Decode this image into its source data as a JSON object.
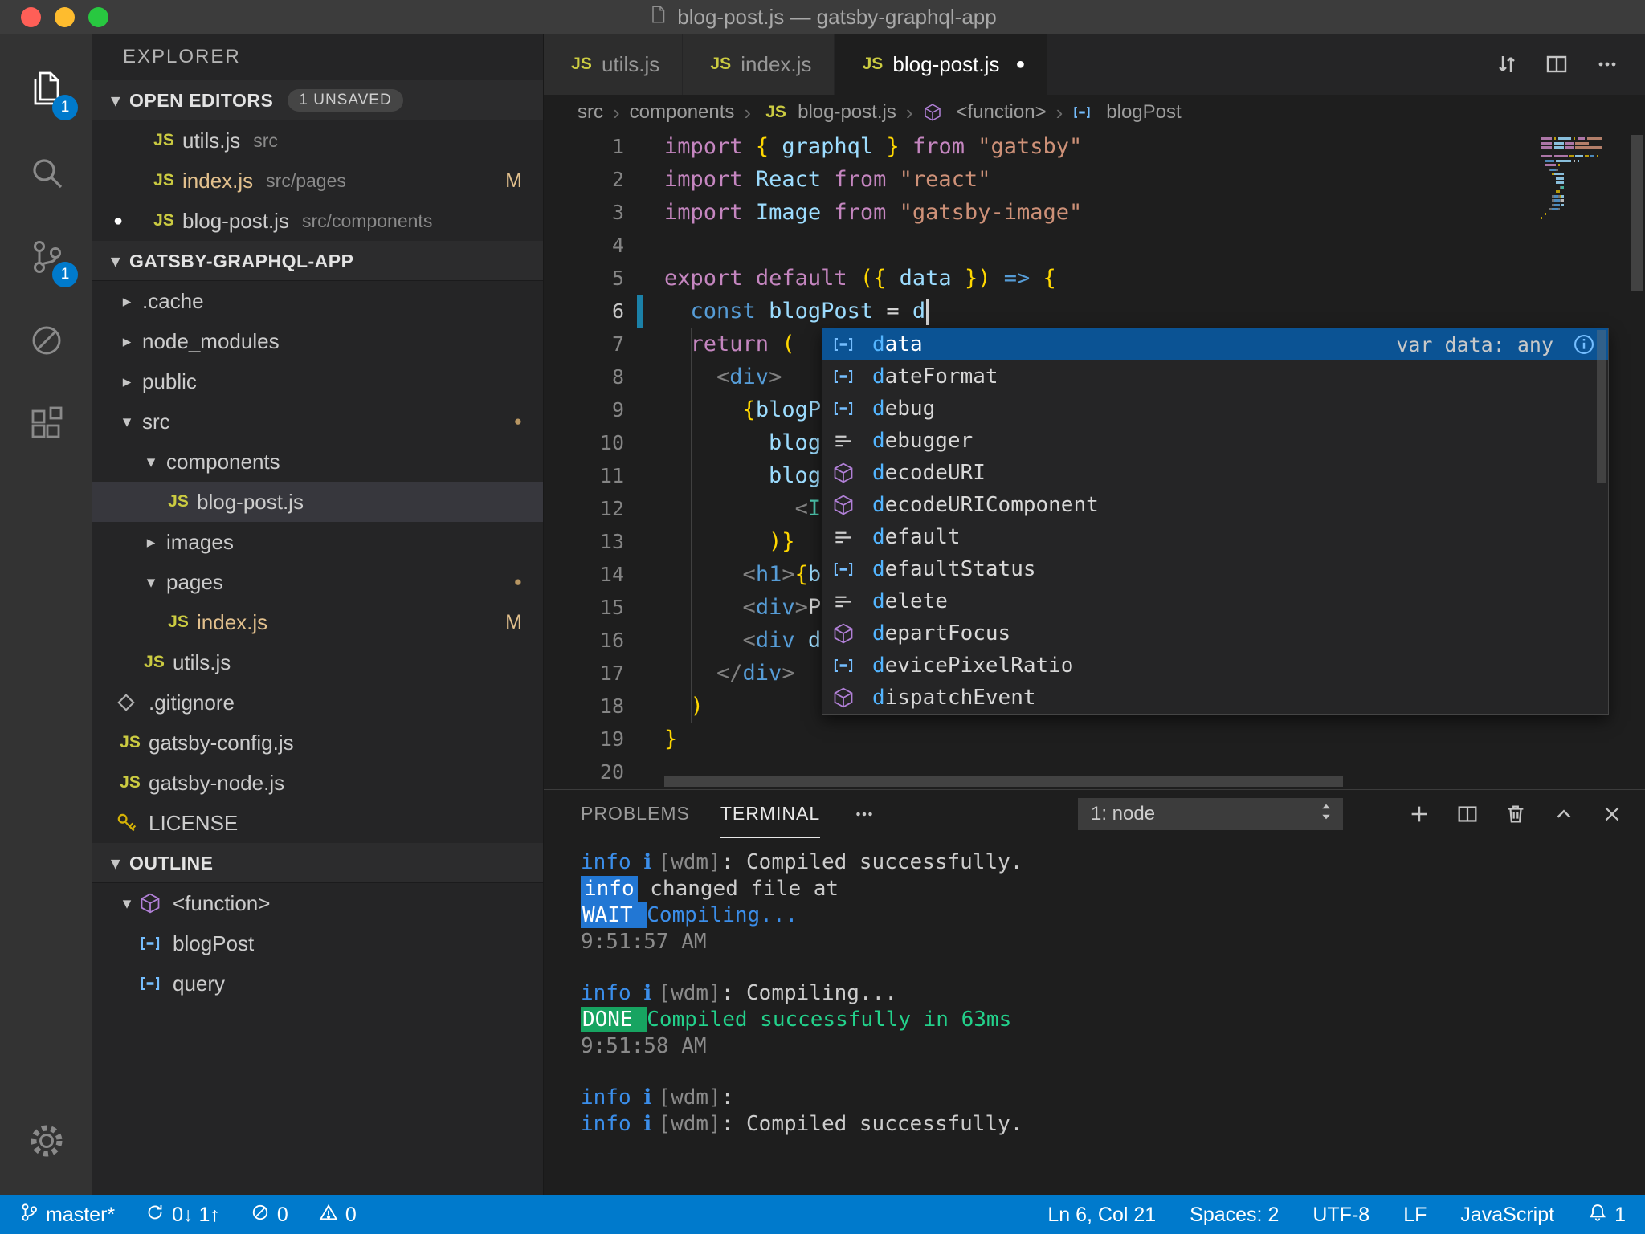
{
  "window": {
    "title": "blog-post.js — gatsby-graphql-app"
  },
  "colors": {
    "accent": "#007acc",
    "status_bar": "#007acc",
    "badge": "#007acc",
    "selection": "#0b5394"
  },
  "activity_bar": {
    "items": [
      {
        "name": "explorer",
        "active": true,
        "badge": "1"
      },
      {
        "name": "search"
      },
      {
        "name": "source-control",
        "badge": "1"
      },
      {
        "name": "debug"
      },
      {
        "name": "extensions"
      }
    ],
    "bottom": [
      {
        "name": "settings"
      }
    ]
  },
  "sidebar": {
    "title": "EXPLORER",
    "sections": [
      {
        "name": "open-editors",
        "label": "OPEN EDITORS",
        "badge": "1 UNSAVED",
        "rows": [
          {
            "label": "utils.js",
            "icon": "js",
            "path": "src"
          },
          {
            "label": "index.js",
            "icon": "js",
            "path": "src/pages",
            "git": "M",
            "modified": true
          },
          {
            "label": "blog-post.js",
            "icon": "js",
            "path": "src/components",
            "dirty": true
          }
        ]
      },
      {
        "name": "workspace",
        "label": "GATSBY-GRAPHQL-APP",
        "rows": [
          {
            "label": ".cache",
            "twisty": "closed",
            "indent": 0
          },
          {
            "label": "node_modules",
            "twisty": "closed",
            "indent": 0
          },
          {
            "label": "public",
            "twisty": "closed",
            "indent": 0
          },
          {
            "label": "src",
            "twisty": "open",
            "indent": 0,
            "dot": true
          },
          {
            "label": "components",
            "twisty": "open",
            "indent": 1
          },
          {
            "label": "blog-post.js",
            "icon": "js",
            "indent": 2,
            "selected": true
          },
          {
            "label": "images",
            "twisty": "closed",
            "indent": 1
          },
          {
            "label": "pages",
            "twisty": "open",
            "indent": 1,
            "dot": true
          },
          {
            "label": "index.js",
            "icon": "js",
            "indent": 2,
            "git": "M",
            "modified": true
          },
          {
            "label": "utils.js",
            "icon": "js",
            "indent": 1
          },
          {
            "label": ".gitignore",
            "icon": "git",
            "indent": 0
          },
          {
            "label": "gatsby-config.js",
            "icon": "js",
            "indent": 0
          },
          {
            "label": "gatsby-node.js",
            "icon": "js",
            "indent": 0
          },
          {
            "label": "LICENSE",
            "icon": "license",
            "indent": 0
          }
        ]
      },
      {
        "name": "outline",
        "label": "OUTLINE",
        "rows": [
          {
            "label": "<function>",
            "twisty": "open",
            "icon": "function",
            "indent": 0
          },
          {
            "label": "blogPost",
            "icon": "variable",
            "indent": 1
          },
          {
            "label": "query",
            "icon": "variable",
            "indent": 1
          }
        ]
      }
    ]
  },
  "editor": {
    "tabs": [
      {
        "label": "utils.js",
        "icon": "js"
      },
      {
        "label": "index.js",
        "icon": "js"
      },
      {
        "label": "blog-post.js",
        "icon": "js",
        "active": true,
        "dirty": true
      }
    ],
    "actions": [
      "swap-editors",
      "split-editor",
      "more-editor-actions"
    ],
    "breadcrumb": [
      {
        "label": "src"
      },
      {
        "label": "components"
      },
      {
        "label": "blog-post.js",
        "icon": "js"
      },
      {
        "label": "<function>",
        "icon": "function"
      },
      {
        "label": "blogPost",
        "icon": "variable"
      }
    ],
    "code": {
      "lines": [
        {
          "n": 1,
          "t": [
            [
              "kw",
              "import"
            ],
            [
              "fg",
              " "
            ],
            [
              "br",
              "{"
            ],
            [
              "fg",
              " "
            ],
            [
              "id",
              "graphql"
            ],
            [
              "fg",
              " "
            ],
            [
              "br",
              "}"
            ],
            [
              "fg",
              " "
            ],
            [
              "kw",
              "from"
            ],
            [
              "fg",
              " "
            ],
            [
              "str",
              "\"gatsby\""
            ]
          ]
        },
        {
          "n": 2,
          "t": [
            [
              "kw",
              "import"
            ],
            [
              "fg",
              " "
            ],
            [
              "id",
              "React"
            ],
            [
              "fg",
              " "
            ],
            [
              "kw",
              "from"
            ],
            [
              "fg",
              " "
            ],
            [
              "str",
              "\"react\""
            ]
          ]
        },
        {
          "n": 3,
          "t": [
            [
              "kw",
              "import"
            ],
            [
              "fg",
              " "
            ],
            [
              "id",
              "Image"
            ],
            [
              "fg",
              " "
            ],
            [
              "kw",
              "from"
            ],
            [
              "fg",
              " "
            ],
            [
              "str",
              "\"gatsby-image\""
            ]
          ]
        },
        {
          "n": 4,
          "t": []
        },
        {
          "n": 5,
          "t": [
            [
              "kw",
              "export"
            ],
            [
              "fg",
              " "
            ],
            [
              "kw",
              "default"
            ],
            [
              "fg",
              " "
            ],
            [
              "br",
              "({"
            ],
            [
              "fg",
              " "
            ],
            [
              "id",
              "data"
            ],
            [
              "fg",
              " "
            ],
            [
              "br",
              "})"
            ],
            [
              "fg",
              " "
            ],
            [
              "op",
              "=>"
            ],
            [
              "fg",
              " "
            ],
            [
              "br",
              "{"
            ]
          ]
        },
        {
          "n": 6,
          "git": true,
          "cursor": true,
          "t": [
            [
              "fg",
              "  "
            ],
            [
              "st",
              "const"
            ],
            [
              "fg",
              " "
            ],
            [
              "id",
              "blogPost"
            ],
            [
              "fg",
              " "
            ],
            [
              "eq",
              "="
            ],
            [
              "fg",
              " "
            ],
            [
              "id",
              "d"
            ]
          ]
        },
        {
          "n": 7,
          "guide": true,
          "t": [
            [
              "fg",
              "  "
            ],
            [
              "kw",
              "return"
            ],
            [
              "fg",
              " "
            ],
            [
              "br",
              "("
            ]
          ]
        },
        {
          "n": 8,
          "guide": true,
          "t": [
            [
              "fg",
              "    "
            ],
            [
              "tb",
              "<"
            ],
            [
              "tg",
              "div"
            ],
            [
              "tb",
              ">"
            ]
          ]
        },
        {
          "n": 9,
          "guide": true,
          "t": [
            [
              "fg",
              "      "
            ],
            [
              "br",
              "{"
            ],
            [
              "id",
              "blogP"
            ]
          ]
        },
        {
          "n": 10,
          "guide": true,
          "t": [
            [
              "fg",
              "        "
            ],
            [
              "id",
              "blog"
            ]
          ]
        },
        {
          "n": 11,
          "guide": true,
          "t": [
            [
              "fg",
              "        "
            ],
            [
              "id",
              "blog"
            ]
          ]
        },
        {
          "n": 12,
          "guide": true,
          "t": [
            [
              "fg",
              "          "
            ],
            [
              "tb",
              "<"
            ],
            [
              "cl",
              "I"
            ]
          ]
        },
        {
          "n": 13,
          "guide": true,
          "t": [
            [
              "fg",
              "        "
            ],
            [
              "br",
              ")}"
            ]
          ]
        },
        {
          "n": 14,
          "guide": true,
          "t": [
            [
              "fg",
              "      "
            ],
            [
              "tb",
              "<"
            ],
            [
              "tg",
              "h1"
            ],
            [
              "tb",
              ">"
            ],
            [
              "br",
              "{"
            ],
            [
              "id",
              "b"
            ]
          ]
        },
        {
          "n": 15,
          "guide": true,
          "t": [
            [
              "fg",
              "      "
            ],
            [
              "tb",
              "<"
            ],
            [
              "tg",
              "div"
            ],
            [
              "tb",
              ">"
            ],
            [
              "fg",
              "P"
            ]
          ]
        },
        {
          "n": 16,
          "guide": true,
          "t": [
            [
              "fg",
              "      "
            ],
            [
              "tb",
              "<"
            ],
            [
              "tg",
              "div"
            ],
            [
              "fg",
              " "
            ],
            [
              "id",
              "d"
            ]
          ]
        },
        {
          "n": 17,
          "guide": true,
          "t": [
            [
              "fg",
              "    "
            ],
            [
              "tb",
              "</"
            ],
            [
              "tg",
              "div"
            ],
            [
              "tb",
              ">"
            ]
          ]
        },
        {
          "n": 18,
          "guide": true,
          "t": [
            [
              "fg",
              "  "
            ],
            [
              "br",
              ")"
            ]
          ]
        },
        {
          "n": 19,
          "t": [
            [
              "br",
              "}"
            ]
          ]
        },
        {
          "n": 20,
          "t": []
        }
      ]
    },
    "suggest": {
      "query": "d",
      "items": [
        {
          "label": "data",
          "kind": "variable",
          "selected": true,
          "detail": "var data: any"
        },
        {
          "label": "dateFormat",
          "kind": "variable"
        },
        {
          "label": "debug",
          "kind": "variable"
        },
        {
          "label": "debugger",
          "kind": "keyword"
        },
        {
          "label": "decodeURI",
          "kind": "function"
        },
        {
          "label": "decodeURIComponent",
          "kind": "function"
        },
        {
          "label": "default",
          "kind": "keyword"
        },
        {
          "label": "defaultStatus",
          "kind": "variable"
        },
        {
          "label": "delete",
          "kind": "keyword"
        },
        {
          "label": "departFocus",
          "kind": "function"
        },
        {
          "label": "devicePixelRatio",
          "kind": "variable"
        },
        {
          "label": "dispatchEvent",
          "kind": "function"
        }
      ]
    }
  },
  "panel": {
    "tabs": [
      {
        "label": "PROBLEMS"
      },
      {
        "label": "TERMINAL",
        "active": true
      }
    ],
    "terminal_select": "1: node",
    "actions": [
      "new-terminal",
      "split-terminal",
      "kill-terminal",
      "maximize-panel",
      "close-panel"
    ],
    "terminal_lines": [
      [
        {
          "c": "b",
          "t": "info "
        },
        {
          "c": "i",
          "t": "ℹ "
        },
        {
          "c": "g",
          "t": "[wdm]"
        },
        {
          "c": "w",
          "t": ": Compiled successfully."
        }
      ],
      [
        {
          "c": "bi",
          "t": "info"
        },
        {
          "c": "w",
          "t": " changed file at"
        }
      ],
      [
        {
          "c": "bw",
          "t": " WAIT "
        },
        {
          "c": "b",
          "t": " Compiling..."
        }
      ],
      [
        {
          "c": "g",
          "t": "9:51:57 AM"
        }
      ],
      [],
      [
        {
          "c": "b",
          "t": "info "
        },
        {
          "c": "i",
          "t": "ℹ "
        },
        {
          "c": "g",
          "t": "[wdm]"
        },
        {
          "c": "w",
          "t": ": Compiling..."
        }
      ],
      [
        {
          "c": "bd",
          "t": " DONE "
        },
        {
          "c": "gr",
          "t": " Compiled successfully in 63ms"
        }
      ],
      [
        {
          "c": "g",
          "t": "9:51:58 AM"
        }
      ],
      [],
      [
        {
          "c": "b",
          "t": "info "
        },
        {
          "c": "i",
          "t": "ℹ "
        },
        {
          "c": "g",
          "t": "[wdm]"
        },
        {
          "c": "w",
          "t": ":"
        }
      ],
      [
        {
          "c": "b",
          "t": "info "
        },
        {
          "c": "i",
          "t": "ℹ "
        },
        {
          "c": "g",
          "t": "[wdm]"
        },
        {
          "c": "w",
          "t": ": Compiled successfully."
        }
      ]
    ]
  },
  "status_bar": {
    "left": [
      {
        "name": "git-branch",
        "icon": "branch",
        "label": "master*"
      },
      {
        "name": "sync-changes",
        "icon": "sync",
        "label": "0↓ 1↑"
      },
      {
        "name": "errors",
        "icon": "error",
        "label": "0"
      },
      {
        "name": "warnings",
        "icon": "warning",
        "label": "0"
      }
    ],
    "right": [
      {
        "name": "cursor-position",
        "label": "Ln 6, Col 21"
      },
      {
        "name": "indentation",
        "label": "Spaces: 2"
      },
      {
        "name": "encoding",
        "label": "UTF-8"
      },
      {
        "name": "eol",
        "label": "LF"
      },
      {
        "name": "language-mode",
        "label": "JavaScript"
      },
      {
        "name": "notifications",
        "icon": "bell",
        "label": "1"
      }
    ]
  }
}
